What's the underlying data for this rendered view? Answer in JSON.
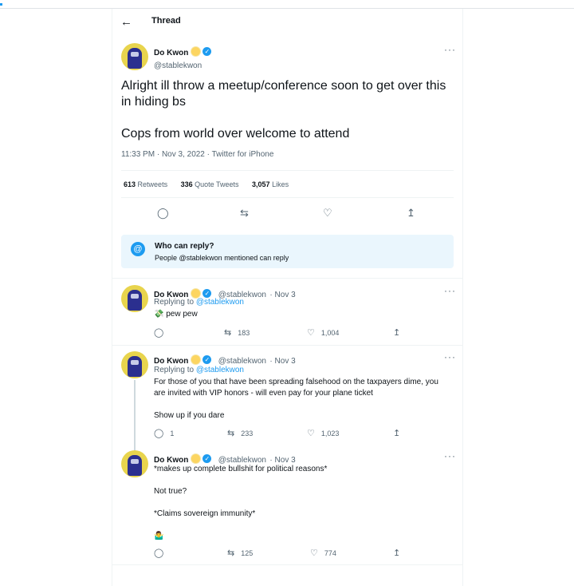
{
  "header": {
    "title": "Thread"
  },
  "main_tweet": {
    "name": "Do Kwon",
    "handle": "@stablekwon",
    "paragraphs": [
      "Alright ill throw a meetup/conference soon to get over this in hiding bs",
      "Cops from world over welcome to attend"
    ],
    "meta": "11:33 PM · Nov 3, 2022 · Twitter for iPhone",
    "stats": [
      {
        "count": "613",
        "label": "Retweets"
      },
      {
        "count": "336",
        "label": "Quote Tweets"
      },
      {
        "count": "3,057",
        "label": "Likes"
      }
    ]
  },
  "who_can_reply": {
    "title": "Who can reply?",
    "text": "People @stablekwon mentioned can reply"
  },
  "replies": [
    {
      "name": "Do Kwon",
      "handle": "@stablekwon",
      "date": "· Nov 3",
      "replying_prefix": "Replying to ",
      "replying_to": "@stablekwon",
      "lines": [
        "💸 pew pew"
      ],
      "reply_count": "",
      "retweets": "183",
      "likes": "1,004"
    },
    {
      "name": "Do Kwon",
      "handle": "@stablekwon",
      "date": "· Nov 3",
      "replying_prefix": "Replying to ",
      "replying_to": "@stablekwon",
      "lines": [
        "For those of you that have been spreading falsehood on the taxpayers dime, you are invited with VIP honors - will even pay for your plane ticket",
        "",
        "Show up if you dare"
      ],
      "reply_count": "1",
      "retweets": "233",
      "likes": "1,023"
    },
    {
      "name": "Do Kwon",
      "handle": "@stablekwon",
      "date": "· Nov 3",
      "lines": [
        "*makes up complete bullshit for political reasons*",
        "",
        "Not true?",
        "",
        "*Claims sovereign immunity*",
        "",
        "🤷‍♂️"
      ],
      "reply_count": "",
      "retweets": "125",
      "likes": "774"
    }
  ]
}
